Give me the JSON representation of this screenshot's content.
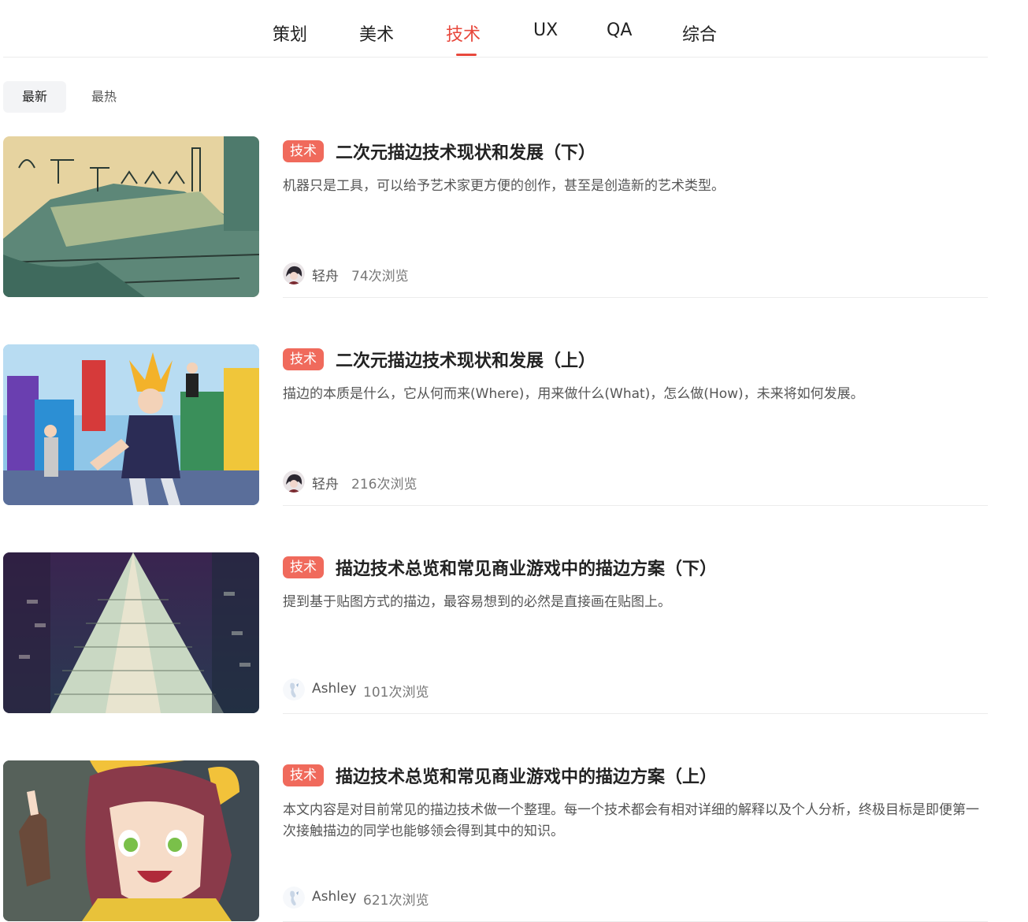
{
  "tabs": [
    {
      "label": "策划"
    },
    {
      "label": "美术"
    },
    {
      "label": "技术"
    },
    {
      "label": "UX"
    },
    {
      "label": "QA"
    },
    {
      "label": "综合"
    }
  ],
  "active_tab": "技术",
  "sort": {
    "newest": "最新",
    "hottest": "最热"
  },
  "articles": [
    {
      "tag": "技术",
      "title": "二次元描边技术现状和发展（下）",
      "desc": "机器只是工具，可以给予艺术家更方便的创作，甚至是创造新的艺术类型。",
      "author": "轻舟",
      "views": "74次浏览"
    },
    {
      "tag": "技术",
      "title": "二次元描边技术现状和发展（上）",
      "desc": "描边的本质是什么，它从何而来(Where)，用来做什么(What)，怎么做(How)，未来将如何发展。",
      "author": "轻舟",
      "views": "216次浏览"
    },
    {
      "tag": "技术",
      "title": "描边技术总览和常见商业游戏中的描边方案（下）",
      "desc": "提到基于贴图方式的描边，最容易想到的必然是直接画在贴图上。",
      "author": "Ashley",
      "views": "101次浏览"
    },
    {
      "tag": "技术",
      "title": "描边技术总览和常见商业游戏中的描边方案（上）",
      "desc": "本文内容是对目前常见的描边技术做一个整理。每一个技术都会有相对详细的解释以及个人分析，终极目标是即便第一次接触描边的同学也能够领会得到其中的知识。",
      "author": "Ashley",
      "views": "621次浏览"
    }
  ],
  "colors": {
    "accent": "#e8483c",
    "tag_bg": "#f06a5c",
    "text": "#222222",
    "muted": "#555555",
    "divider": "#ececec"
  }
}
